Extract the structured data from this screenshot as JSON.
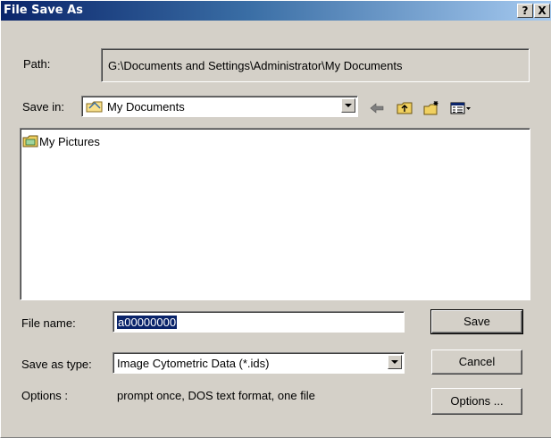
{
  "window": {
    "title": "File Save As",
    "help_label": "?",
    "close_label": "X"
  },
  "path": {
    "label": "Path:",
    "value": "G:\\Documents and Settings\\Administrator\\My Documents"
  },
  "save_in": {
    "label": "Save in:",
    "value": "My Documents"
  },
  "toolbar": {
    "back_icon": "left-arrow-icon",
    "up_icon": "folder-up-icon",
    "new_folder_icon": "new-folder-icon",
    "view_menu_icon": "view-menu-icon"
  },
  "file_list": {
    "items": [
      {
        "label": "My Pictures",
        "icon": "pictures-folder-icon"
      }
    ]
  },
  "file_name": {
    "label": "File name:",
    "value": "a00000000"
  },
  "save_as_type": {
    "label": "Save as type:",
    "value": "Image Cytometric Data (*.ids)"
  },
  "options": {
    "label": "Options :",
    "value": "prompt once, DOS text format, one file"
  },
  "buttons": {
    "save": "Save",
    "cancel": "Cancel",
    "options": "Options ..."
  },
  "colors": {
    "title_start": "#0a246a",
    "title_end": "#a6caf0",
    "face": "#d4d0c8",
    "selection": "#0a246a"
  }
}
